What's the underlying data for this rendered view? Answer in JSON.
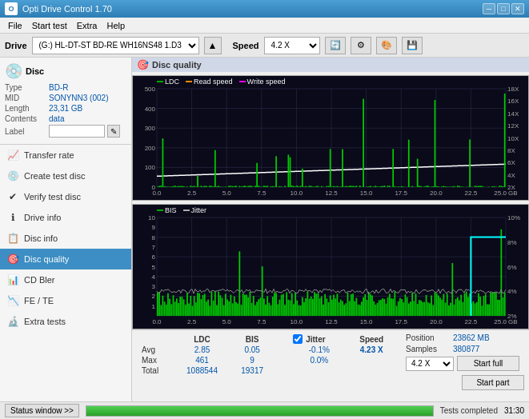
{
  "window": {
    "title": "Opti Drive Control 1.70",
    "minimize": "─",
    "maximize": "□",
    "close": "✕"
  },
  "menu": {
    "items": [
      "File",
      "Start test",
      "Extra",
      "Help"
    ]
  },
  "drivebar": {
    "label": "Drive",
    "drive_value": "(G:)  HL-DT-ST BD-RE  WH16NS48 1.D3",
    "speed_label": "Speed",
    "speed_value": "4.2 X"
  },
  "disc": {
    "title": "Disc",
    "type_label": "Type",
    "type_val": "BD-R",
    "mid_label": "MID",
    "mid_val": "SONYNN3 (002)",
    "length_label": "Length",
    "length_val": "23,31 GB",
    "contents_label": "Contents",
    "contents_val": "data",
    "label_label": "Label"
  },
  "nav": {
    "items": [
      {
        "label": "Transfer rate",
        "icon": "📈"
      },
      {
        "label": "Create test disc",
        "icon": "💿"
      },
      {
        "label": "Verify test disc",
        "icon": "✔"
      },
      {
        "label": "Drive info",
        "icon": "ℹ"
      },
      {
        "label": "Disc info",
        "icon": "📋"
      },
      {
        "label": "Disc quality",
        "icon": "🎯",
        "active": true
      },
      {
        "label": "CD Bler",
        "icon": "📊"
      },
      {
        "label": "FE / TE",
        "icon": "📉"
      },
      {
        "label": "Extra tests",
        "icon": "🔬"
      }
    ]
  },
  "chart": {
    "title": "Disc quality",
    "title_icon": "🎯",
    "top": {
      "legend": [
        {
          "label": "LDC",
          "color": "#00aa00"
        },
        {
          "label": "Read speed",
          "color": "#ff6600"
        },
        {
          "label": "Write speed",
          "color": "#ff00ff"
        }
      ],
      "y_max": 500,
      "y_labels": [
        "500",
        "400",
        "300",
        "200",
        "100",
        "0"
      ],
      "y_right_labels": [
        "18X",
        "16X",
        "14X",
        "12X",
        "10X",
        "8X",
        "6X",
        "4X",
        "2X"
      ],
      "x_labels": [
        "0.0",
        "2.5",
        "5.0",
        "7.5",
        "10.0",
        "12.5",
        "15.0",
        "17.5",
        "20.0",
        "22.5",
        "25.0 GB"
      ]
    },
    "bottom": {
      "legend": [
        {
          "label": "BIS",
          "color": "#00aa00"
        },
        {
          "label": "Jitter",
          "color": "#aaaaaa"
        }
      ],
      "y_max": 10,
      "y_labels": [
        "10",
        "9",
        "8",
        "7",
        "6",
        "5",
        "4",
        "3",
        "2",
        "1"
      ],
      "y_right_labels": [
        "10%",
        "8%",
        "6%",
        "4%",
        "2%"
      ],
      "x_labels": [
        "0.0",
        "2.5",
        "5.0",
        "7.5",
        "10.0",
        "12.5",
        "15.0",
        "17.5",
        "20.0",
        "22.5",
        "25.0 GB"
      ]
    }
  },
  "stats": {
    "headers": [
      "LDC",
      "BIS",
      "",
      "Jitter",
      "Speed"
    ],
    "avg_label": "Avg",
    "avg_ldc": "2.85",
    "avg_bis": "0.05",
    "avg_jitter": "-0.1%",
    "max_label": "Max",
    "max_ldc": "461",
    "max_bis": "9",
    "max_jitter": "0.0%",
    "total_label": "Total",
    "total_ldc": "1088544",
    "total_bis": "19317",
    "jitter_checked": true,
    "jitter_label": "Jitter",
    "speed_val": "4.23 X",
    "speed_color": "#0055aa",
    "position_label": "Position",
    "position_val": "23862 MB",
    "samples_label": "Samples",
    "samples_val": "380877",
    "speed_select": "4.2 X",
    "start_full_label": "Start full",
    "start_part_label": "Start part"
  },
  "statusbar": {
    "window_btn": "Status window >>",
    "progress": 100,
    "status_text": "Tests completed",
    "time": "31:30"
  }
}
